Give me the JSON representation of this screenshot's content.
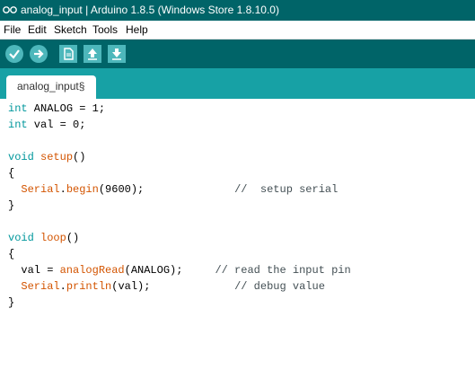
{
  "window": {
    "title": "analog_input | Arduino 1.8.5 (Windows Store 1.8.10.0)"
  },
  "menu": [
    "File",
    "Edit",
    "Sketch",
    "Tools",
    "Help"
  ],
  "toolbar": {
    "buttons": [
      {
        "name": "verify",
        "icon": "check-icon"
      },
      {
        "name": "upload",
        "icon": "arrow-right-icon"
      },
      {
        "name": "new",
        "icon": "new-file-icon"
      },
      {
        "name": "open",
        "icon": "arrow-up-icon"
      },
      {
        "name": "save",
        "icon": "arrow-down-icon"
      }
    ]
  },
  "tab": {
    "label": "analog_input§"
  },
  "code": {
    "l1": {
      "kw": "int",
      "rest": " ANALOG = 1;"
    },
    "l2": {
      "kw": "int",
      "rest": " val = 0;"
    },
    "l4": {
      "kw": "void",
      "fn": "setup",
      "rest": "()"
    },
    "l5": "{",
    "l6": {
      "indent": "  ",
      "fn": "Serial",
      "dot": ".",
      "fn2": "begin",
      "rest": "(9600);              ",
      "comment": "//  setup serial"
    },
    "l7": "}",
    "l9": {
      "kw": "void",
      "fn": "loop",
      "rest": "()"
    },
    "l10": "{",
    "l11": {
      "pre": "  val = ",
      "fn": "analogRead",
      "rest": "(ANALOG);     ",
      "comment": "// read the input pin"
    },
    "l12": {
      "indent": "  ",
      "fn": "Serial",
      "dot": ".",
      "fn2": "println",
      "rest": "(val);             ",
      "comment": "// debug value"
    },
    "l13": "}"
  },
  "colors": {
    "teal_dark": "#006468",
    "teal_tab": "#17a1a5",
    "button": "#4db7bb",
    "keyword": "#00979c",
    "function": "#d35400"
  }
}
